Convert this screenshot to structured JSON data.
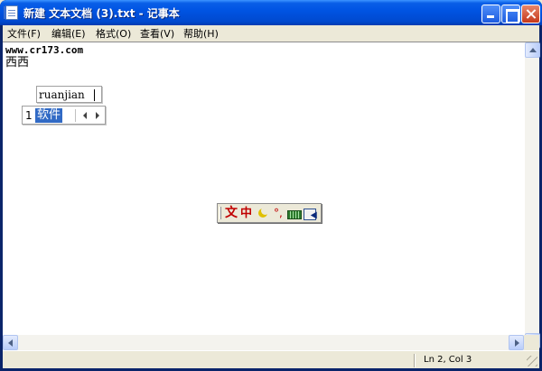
{
  "window": {
    "title": "新建 文本文档 (3).txt - 记事本"
  },
  "menu": {
    "items": [
      {
        "label": "文件(F)"
      },
      {
        "label": "编辑(E)"
      },
      {
        "label": "格式(O)"
      },
      {
        "label": "查看(V)"
      },
      {
        "label": "帮助(H)"
      }
    ]
  },
  "document": {
    "lines": [
      "www.cr173.com",
      "西西"
    ]
  },
  "ime": {
    "composition": "ruanjian",
    "candidate_index": "1",
    "candidate_word": "软件",
    "mode_label": "中",
    "punct_label": "°,"
  },
  "status": {
    "position": "Ln 2, Col 3"
  },
  "icons": {
    "app": "notepad-icon",
    "minimize": "minimize-icon",
    "maximize": "maximize-icon",
    "close": "close-icon"
  },
  "colors": {
    "titlebar": "#0054e3",
    "selection": "#316ac5",
    "ime_accent": "#c00000"
  }
}
